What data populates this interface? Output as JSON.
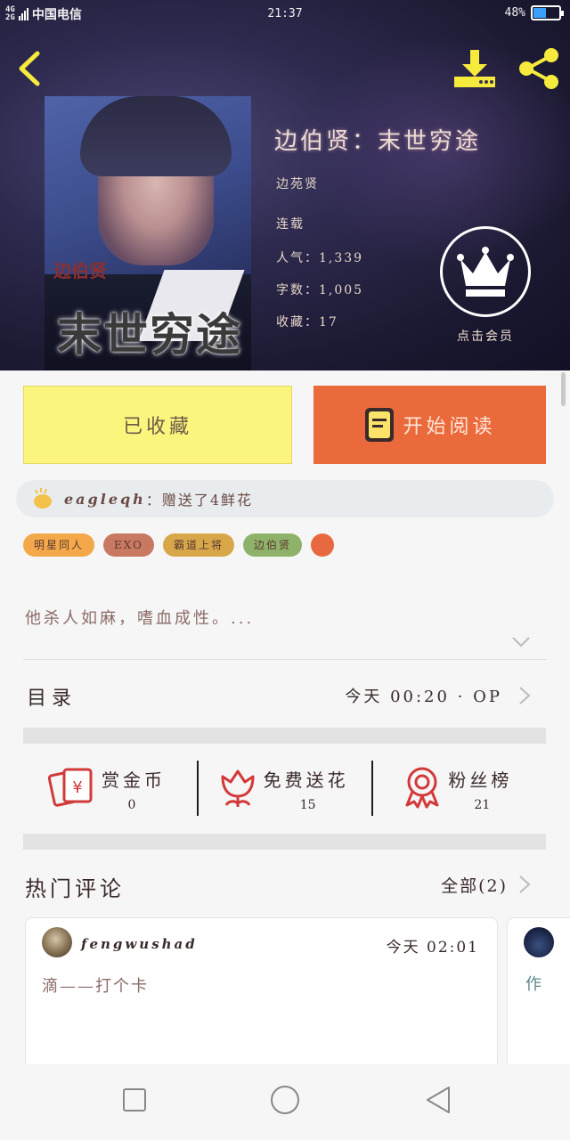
{
  "status_bar": {
    "network": "4G\n2G",
    "carrier": "中国电信",
    "time": "21:37",
    "battery": "48%",
    "battery_level": 0.48
  },
  "book": {
    "title": "边伯贤：末世穷途",
    "author": "边苑贤",
    "status": "连载",
    "popularity": "人气：1,339",
    "word_count": "字数：1,005",
    "favorites": "收藏：17",
    "cover_small_text": "边伯贤",
    "cover_big_text": "末世穷途"
  },
  "vip": {
    "label": "点击会员"
  },
  "actions": {
    "favorited_label": "已收藏",
    "read_label": "开始阅读"
  },
  "gift": {
    "user": "eagleqh",
    "text": "：赠送了4鲜花"
  },
  "tags": [
    {
      "label": "明星同人",
      "color": "#f4a84a"
    },
    {
      "label": "EXO",
      "color": "#c97862"
    },
    {
      "label": "霸道上将",
      "color": "#d7a74a"
    },
    {
      "label": "边伯贤",
      "color": "#8fb26a"
    },
    {
      "label": "",
      "color": "#e8693f"
    }
  ],
  "summary": "他杀人如麻，嗜血成性。...",
  "toc": {
    "title": "目录",
    "updated": "今天 00:20 · OP"
  },
  "stats": [
    {
      "label": "赏金币",
      "value": "0",
      "icon": "reward-coin-icon"
    },
    {
      "label": "免费送花",
      "value": "15",
      "icon": "flower-icon"
    },
    {
      "label": "粉丝榜",
      "value": "21",
      "icon": "ribbon-badge-icon"
    }
  ],
  "comments": {
    "title": "热门评论",
    "all_label": "全部(2)",
    "items": [
      {
        "user": "fengwushad",
        "time": "今天 02:01",
        "text": "滴——打个卡"
      },
      {
        "text": "作"
      }
    ]
  },
  "colors": {
    "accent_orange": "#ea6a3c",
    "fav_yellow": "#fbf47d",
    "back_icon_yellow": "#f6ea3c"
  }
}
